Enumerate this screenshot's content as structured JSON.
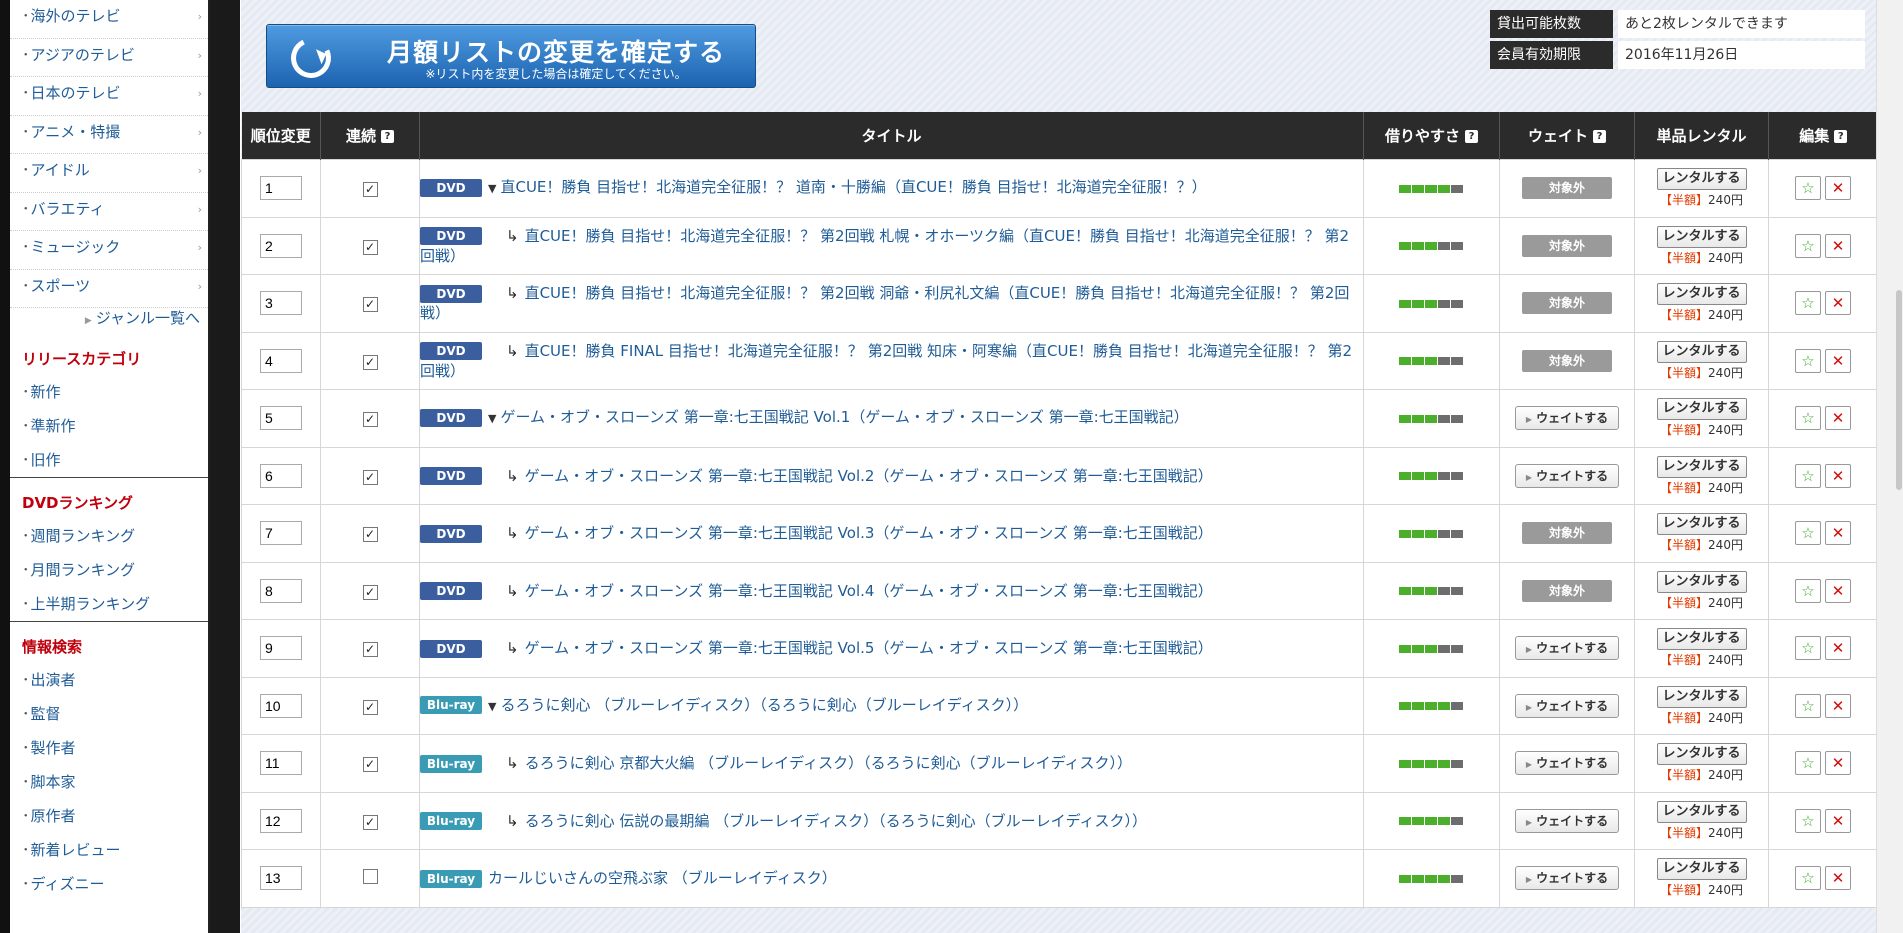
{
  "sidebar": {
    "genres": [
      {
        "label": "海外のテレビ"
      },
      {
        "label": "アジアのテレビ"
      },
      {
        "label": "日本のテレビ"
      },
      {
        "label": "アニメ・特撮"
      },
      {
        "label": "アイドル"
      },
      {
        "label": "バラエティ"
      },
      {
        "label": "ミュージック"
      },
      {
        "label": "スポーツ"
      }
    ],
    "genre_more": "ジャンル一覧へ",
    "release_heading": "リリースカテゴリ",
    "release_items": [
      "新作",
      "準新作",
      "旧作"
    ],
    "ranking_heading": "DVDランキング",
    "ranking_items": [
      "週間ランキング",
      "月間ランキング",
      "上半期ランキング"
    ],
    "search_heading": "情報検索",
    "search_items": [
      "出演者",
      "監督",
      "製作者",
      "脚本家",
      "原作者",
      "新着レビュー",
      "ディズニー"
    ]
  },
  "confirm_button": {
    "label": "月額リストの変更を確定する",
    "sublabel": "※リスト内を変更した場合は確定してください。"
  },
  "info": {
    "rentable_label": "貸出可能枚数",
    "rentable_value": "あと2枚レンタルできます",
    "expiry_label": "会員有効期限",
    "expiry_value": "2016年11月26日"
  },
  "table": {
    "headers": {
      "order": "順位変更",
      "continuous": "連続",
      "title": "タイトル",
      "availability": "借りやすさ",
      "wait": "ウェイト",
      "single": "単品レンタル",
      "edit": "編集"
    },
    "rows": [
      {
        "order": "1",
        "checked": true,
        "media": "DVD",
        "expand": true,
        "child": false,
        "title": "直CUE！勝負 目指せ！北海道完全征服！？ 道南・十勝編（直CUE！勝負 目指せ！北海道完全征服！？）",
        "availability": 4,
        "wait": "対象外"
      },
      {
        "order": "2",
        "checked": true,
        "media": "DVD",
        "expand": false,
        "child": true,
        "title": "直CUE！勝負 目指せ！北海道完全征服！？ 第2回戦 札幌・オホーツク編（直CUE！勝負 目指せ！北海道完全征服！？ 第2回戦）",
        "availability": 3,
        "wait": "対象外"
      },
      {
        "order": "3",
        "checked": true,
        "media": "DVD",
        "expand": false,
        "child": true,
        "title": "直CUE！勝負 目指せ！北海道完全征服！？ 第2回戦 洞爺・利尻礼文編（直CUE！勝負 目指せ！北海道完全征服！？ 第2回戦）",
        "availability": 3,
        "wait": "対象外"
      },
      {
        "order": "4",
        "checked": true,
        "media": "DVD",
        "expand": false,
        "child": true,
        "title": "直CUE！勝負 FINAL 目指せ！北海道完全征服！？ 第2回戦 知床・阿寒編（直CUE！勝負 目指せ！北海道完全征服！？ 第2回戦）",
        "availability": 3,
        "wait": "対象外"
      },
      {
        "order": "5",
        "checked": true,
        "media": "DVD",
        "expand": true,
        "child": false,
        "title": "ゲーム・オブ・スローンズ 第一章:七王国戦記 Vol.1（ゲーム・オブ・スローンズ 第一章:七王国戦記）",
        "availability": 3,
        "wait": "ウェイトする"
      },
      {
        "order": "6",
        "checked": true,
        "media": "DVD",
        "expand": false,
        "child": true,
        "title": "ゲーム・オブ・スローンズ 第一章:七王国戦記 Vol.2（ゲーム・オブ・スローンズ 第一章:七王国戦記）",
        "availability": 3,
        "wait": "ウェイトする"
      },
      {
        "order": "7",
        "checked": true,
        "media": "DVD",
        "expand": false,
        "child": true,
        "title": "ゲーム・オブ・スローンズ 第一章:七王国戦記 Vol.3（ゲーム・オブ・スローンズ 第一章:七王国戦記）",
        "availability": 3,
        "wait": "対象外"
      },
      {
        "order": "8",
        "checked": true,
        "media": "DVD",
        "expand": false,
        "child": true,
        "title": "ゲーム・オブ・スローンズ 第一章:七王国戦記 Vol.4（ゲーム・オブ・スローンズ 第一章:七王国戦記）",
        "availability": 3,
        "wait": "対象外"
      },
      {
        "order": "9",
        "checked": true,
        "media": "DVD",
        "expand": false,
        "child": true,
        "title": "ゲーム・オブ・スローンズ 第一章:七王国戦記 Vol.5（ゲーム・オブ・スローンズ 第一章:七王国戦記）",
        "availability": 3,
        "wait": "ウェイトする"
      },
      {
        "order": "10",
        "checked": true,
        "media": "Blu-ray",
        "expand": true,
        "child": false,
        "title": "るろうに剣心 （ブルーレイディスク）（るろうに剣心（ブルーレイディスク））",
        "availability": 4,
        "wait": "ウェイトする"
      },
      {
        "order": "11",
        "checked": true,
        "media": "Blu-ray",
        "expand": false,
        "child": true,
        "title": "るろうに剣心 京都大火編 （ブルーレイディスク）（るろうに剣心（ブルーレイディスク））",
        "availability": 4,
        "wait": "ウェイトする"
      },
      {
        "order": "12",
        "checked": true,
        "media": "Blu-ray",
        "expand": false,
        "child": true,
        "title": "るろうに剣心 伝説の最期編 （ブルーレイディスク）（るろうに剣心（ブルーレイディスク））",
        "availability": 4,
        "wait": "ウェイトする"
      },
      {
        "order": "13",
        "checked": false,
        "media": "Blu-ray",
        "expand": false,
        "child": false,
        "title": "カールじいさんの空飛ぶ家 （ブルーレイディスク）",
        "availability": 4,
        "wait": "ウェイトする"
      }
    ],
    "rent_label": "レンタルする",
    "price_half": "【半額】",
    "price_value": "240円",
    "out_of_scope": "対象外"
  },
  "colors": {
    "accent_blue": "#1f5c97",
    "heading_red": "#c0000b",
    "bar_on": "#4caf2c",
    "bar_off": "#6d6d6d"
  }
}
